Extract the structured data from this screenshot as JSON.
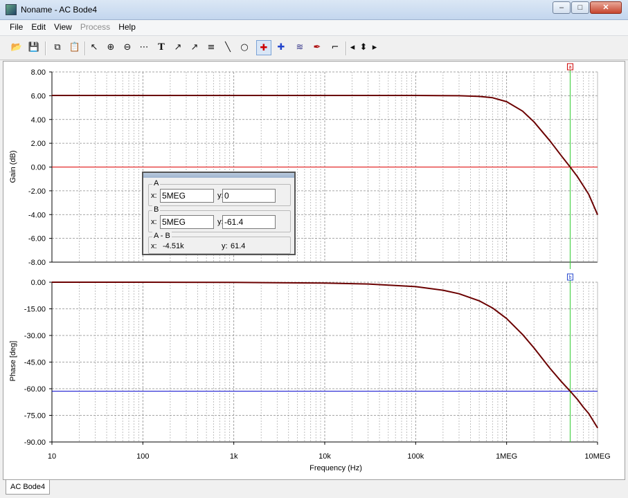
{
  "window": {
    "title": "Noname - AC Bode4",
    "minimize": "‒",
    "maximize": "□",
    "close": "✕"
  },
  "menu": [
    {
      "label": "File",
      "enabled": true
    },
    {
      "label": "Edit",
      "enabled": true
    },
    {
      "label": "View",
      "enabled": true
    },
    {
      "label": "Process",
      "enabled": false
    },
    {
      "label": "Help",
      "enabled": true
    }
  ],
  "toolbar": [
    {
      "icon": "open-folder-icon",
      "glyph": "📂"
    },
    {
      "icon": "save-icon",
      "glyph": "💾"
    },
    {
      "icon": "copy-icon",
      "glyph": "⧉"
    },
    {
      "icon": "paste-icon",
      "glyph": "📋"
    },
    {
      "icon": "pointer-icon",
      "glyph": "↖"
    },
    {
      "icon": "zoom-in-icon",
      "glyph": "⊕"
    },
    {
      "icon": "zoom-100-icon",
      "glyph": "⊖"
    },
    {
      "icon": "grid-icon",
      "glyph": "⋯"
    },
    {
      "icon": "text-tool-icon",
      "glyph": "T"
    },
    {
      "icon": "label-curve-icon",
      "glyph": "↗"
    },
    {
      "icon": "label-point-icon",
      "glyph": "↗"
    },
    {
      "icon": "label-axis-icon",
      "glyph": "≡"
    },
    {
      "icon": "line-tool-icon",
      "glyph": "╲"
    },
    {
      "icon": "circle-tool-icon",
      "glyph": "○"
    },
    {
      "icon": "cursor-a-icon",
      "glyph": "✚"
    },
    {
      "icon": "cursor-b-icon",
      "glyph": "✚"
    },
    {
      "icon": "add-curve-icon",
      "glyph": "≋"
    },
    {
      "icon": "add-marker-icon",
      "glyph": "✒"
    },
    {
      "icon": "step-icon",
      "glyph": "⌐"
    },
    {
      "icon": "arrow-left-icon",
      "glyph": "◂"
    },
    {
      "icon": "arrow-updown-icon",
      "glyph": "⬍"
    },
    {
      "icon": "arrow-right-icon",
      "glyph": "▸"
    }
  ],
  "cursor_panel": {
    "a_label": "A",
    "a_x": "5MEG",
    "a_y": "0",
    "b_label": "B",
    "b_x": "5MEG",
    "b_y": "-61.4",
    "diff_label": "A - B",
    "diff_x": "-4.51k",
    "diff_y": "61.4",
    "x_key": "x:",
    "y_key": "y:"
  },
  "tab": {
    "label": "AC Bode4"
  },
  "colors": {
    "curve": "#6b0000",
    "cursor_line": "#33cc33",
    "gain_ref": "#dd0000",
    "phase_ref": "#0000cc",
    "grid": "#b0b0b0"
  },
  "chart_data": [
    {
      "type": "line",
      "ylabel": "Gain (dB)",
      "xscale": "log",
      "xlim": [
        10,
        10000000
      ],
      "ylim": [
        -8,
        8
      ],
      "yticks": [
        "8.00",
        "6.00",
        "4.00",
        "2.00",
        "0.00",
        "-2.00",
        "-4.00",
        "-6.00",
        "-8.00"
      ],
      "ytick_values": [
        8,
        6,
        4,
        2,
        0,
        -2,
        -4,
        -6,
        -8
      ],
      "series": [
        {
          "x": [
            10,
            100,
            1000,
            10000,
            100000,
            300000,
            500000,
            700000,
            1000000,
            1500000,
            2000000,
            3000000,
            4000000,
            5000000,
            6000000,
            7000000,
            8000000,
            10000000
          ],
          "y": [
            6.02,
            6.02,
            6.02,
            6.02,
            6.02,
            6.0,
            5.94,
            5.83,
            5.5,
            4.7,
            3.8,
            2.2,
            0.95,
            0.0,
            -0.8,
            -1.6,
            -2.3,
            -4.0
          ]
        }
      ],
      "cursor_x": 5000000,
      "reference_y": 0,
      "cursor_marker": "a",
      "grid": true
    },
    {
      "type": "line",
      "xlabel": "Frequency (Hz)",
      "ylabel": "Phase [deg]",
      "xscale": "log",
      "xlim": [
        10,
        10000000
      ],
      "ylim": [
        -90,
        0
      ],
      "yticks": [
        "0.00",
        "-15.00",
        "-30.00",
        "-45.00",
        "-60.00",
        "-75.00",
        "-90.00"
      ],
      "ytick_values": [
        0,
        -15,
        -30,
        -45,
        -60,
        -75,
        -90
      ],
      "xticks": [
        "10",
        "100",
        "1k",
        "10k",
        "100k",
        "1MEG",
        "10MEG"
      ],
      "xtick_values": [
        10,
        100,
        1000,
        10000,
        100000,
        1000000,
        10000000
      ],
      "series": [
        {
          "x": [
            10,
            100,
            1000,
            10000,
            30000,
            100000,
            200000,
            300000,
            500000,
            700000,
            1000000,
            1500000,
            2000000,
            3000000,
            4000000,
            5000000,
            6000000,
            7000000,
            8000000,
            10000000
          ],
          "y": [
            0,
            0,
            -0.1,
            -0.5,
            -1.0,
            -2.5,
            -4.5,
            -6.5,
            -10.5,
            -14.5,
            -20.5,
            -29.5,
            -37.0,
            -48.5,
            -56.0,
            -61.4,
            -66.0,
            -70.5,
            -74.0,
            -82.0
          ]
        }
      ],
      "cursor_x": 5000000,
      "reference_y": -61.4,
      "cursor_marker": "b",
      "grid": true
    }
  ]
}
